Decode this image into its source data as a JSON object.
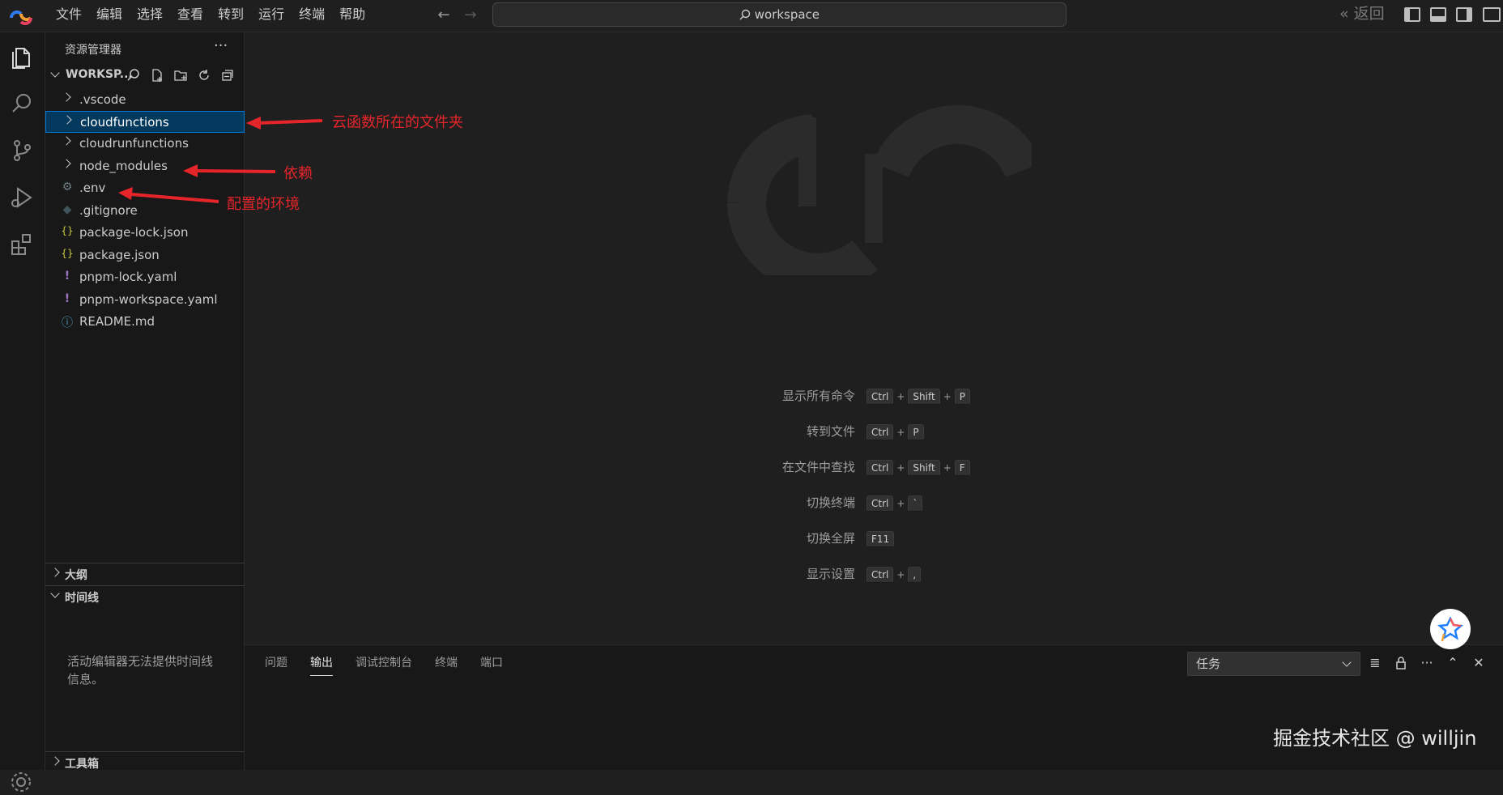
{
  "titlebar": {
    "menu": [
      "文件",
      "编辑",
      "选择",
      "查看",
      "转到",
      "运行",
      "终端",
      "帮助"
    ],
    "search_text": "workspace",
    "back_label": "« 返回"
  },
  "sidebar": {
    "title": "资源管理器",
    "more": "···",
    "workspace_name": "WORKSP...",
    "tree": [
      {
        "label": ".vscode",
        "kind": "folder"
      },
      {
        "label": "cloudfunctions",
        "kind": "folder",
        "selected": true
      },
      {
        "label": "cloudrunfunctions",
        "kind": "folder"
      },
      {
        "label": "node_modules",
        "kind": "folder"
      },
      {
        "label": ".env",
        "kind": "gear-file",
        "icon": "⚙"
      },
      {
        "label": ".gitignore",
        "kind": "git-file",
        "icon": "◆"
      },
      {
        "label": "package-lock.json",
        "kind": "json-file",
        "icon": "{}"
      },
      {
        "label": "package.json",
        "kind": "json-file",
        "icon": "{}"
      },
      {
        "label": "pnpm-lock.yaml",
        "kind": "yaml-file",
        "icon": "!"
      },
      {
        "label": "pnpm-workspace.yaml",
        "kind": "yaml-file",
        "icon": "!"
      },
      {
        "label": "README.md",
        "kind": "info-file",
        "icon": "ⓘ"
      }
    ],
    "outline_label": "大纲",
    "timeline_label": "时间线",
    "timeline_message": "活动编辑器无法提供时间线信息。",
    "toolbox_label": "工具箱"
  },
  "annotations": {
    "cloudfunctions": "云函数所在的文件夹",
    "node_modules": "依赖",
    "env": "配置的环境"
  },
  "shortcuts": [
    {
      "label": "显示所有命令",
      "keys": [
        "Ctrl",
        "Shift",
        "P"
      ]
    },
    {
      "label": "转到文件",
      "keys": [
        "Ctrl",
        "P"
      ]
    },
    {
      "label": "在文件中查找",
      "keys": [
        "Ctrl",
        "Shift",
        "F"
      ]
    },
    {
      "label": "切换终端",
      "keys": [
        "Ctrl",
        "`"
      ]
    },
    {
      "label": "切换全屏",
      "keys": [
        "F11"
      ]
    },
    {
      "label": "显示设置",
      "keys": [
        "Ctrl",
        ","
      ]
    }
  ],
  "panel": {
    "tabs": [
      "问题",
      "输出",
      "调试控制台",
      "终端",
      "端口"
    ],
    "active_tab": "输出",
    "select_value": "任务"
  },
  "credit": "掘金技术社区 @ willjin",
  "colors": {
    "accent": "#0078d4",
    "selection": "#04395e",
    "annotation": "#e6252b"
  }
}
